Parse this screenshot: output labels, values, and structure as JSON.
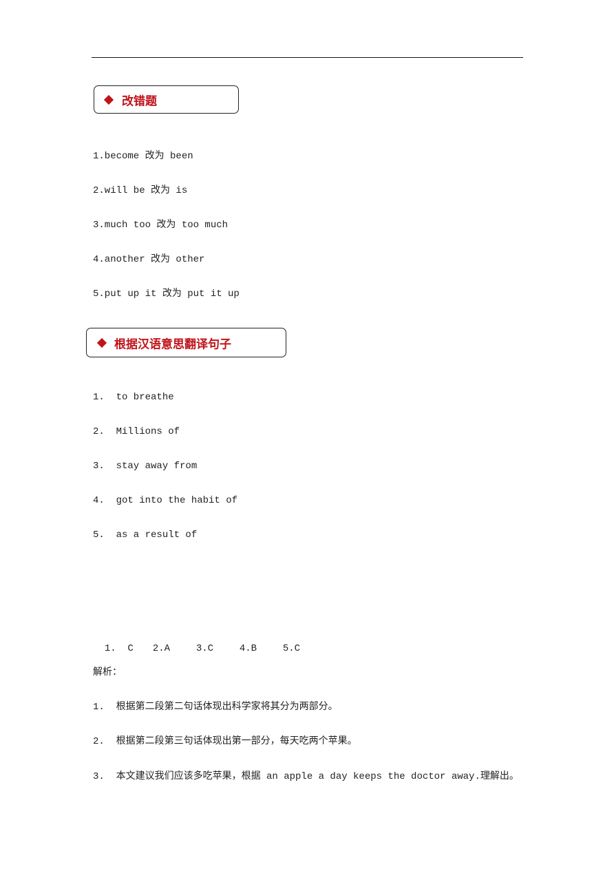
{
  "sections": [
    {
      "title": "改错题",
      "items": [
        "1.become 改为 been",
        "2.will be 改为 is",
        "3.much too 改为 too much",
        "4.another 改为 other",
        "5.put up it 改为 put it up"
      ]
    },
    {
      "title": "根据汉语意思翻译句子",
      "items": [
        "1.  to breathe",
        "2.  Millions of",
        "3.  stay away from",
        "4.  got into the habit of",
        "5.  as a result of"
      ]
    }
  ],
  "answers": [
    "1.  C",
    "2.A",
    "3.C",
    "4.B",
    "5.C"
  ],
  "analysis": {
    "label": "解析：",
    "items": [
      "1.  根据第二段第二句话体现出科学家将其分为两部分。",
      "2.  根据第二段第三句话体现出第一部分，每天吃两个苹果。",
      "3.  本文建议我们应该多吃苹果，根据 an apple a day keeps the doctor away.理解出。"
    ]
  },
  "colors": {
    "accent": "#c0141b"
  }
}
